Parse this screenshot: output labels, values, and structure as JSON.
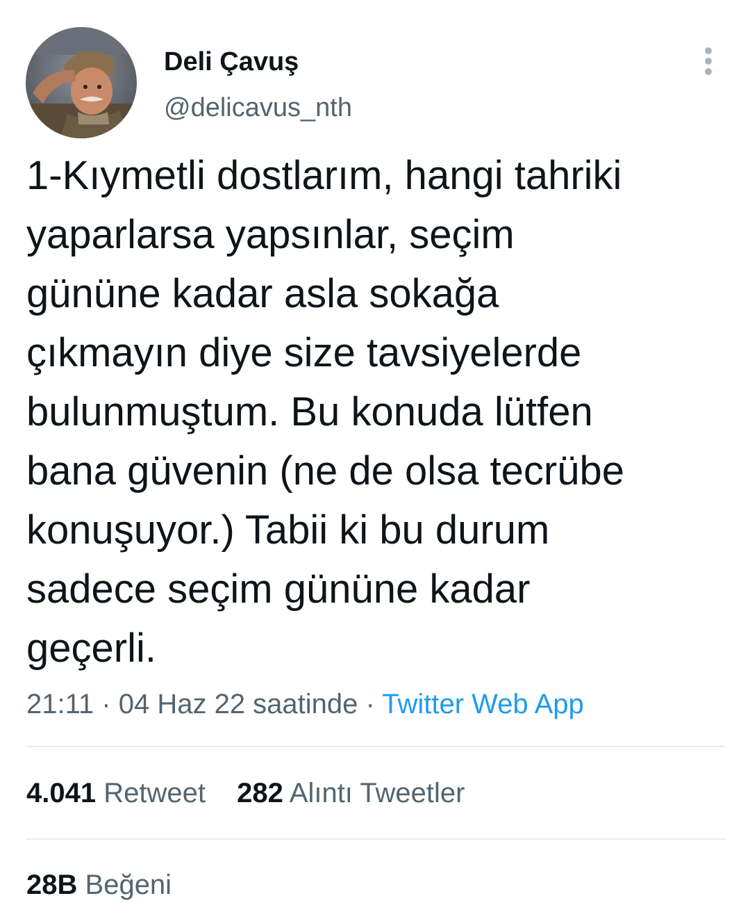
{
  "author": {
    "display_name": "Deli Çavuş",
    "handle": "@delicavus_nth",
    "avatar_icon": "profile-photo"
  },
  "actions": {
    "more_icon": "more-vertical-icon"
  },
  "tweet": {
    "text": "1-Kıymetli dostlarım, hangi tahriki\nyaparlarsa yapsınlar, seçim\ngününe kadar asla sokağa\nçıkmayın diye size tavsiyelerde\nbulunmuştum. Bu konuda lütfen\nbana güvenin (ne de olsa tecrübe\nkonuşuyor.) Tabii ki bu durum\nsadece seçim gününe kadar\ngeçerli.",
    "time": "21:11",
    "separator": "·",
    "date": "04 Haz 22 saatinde",
    "source": "Twitter Web App"
  },
  "stats": {
    "retweets": {
      "count": "4.041",
      "label": "Retweet"
    },
    "quotes": {
      "count": "282",
      "label": "Alıntı Tweetler"
    },
    "likes": {
      "count": "28B",
      "label": "Beğeni"
    }
  },
  "colors": {
    "text_primary": "#0f1419",
    "text_secondary": "#536471",
    "link": "#1d9bf0",
    "divider": "#e6ecf0"
  }
}
